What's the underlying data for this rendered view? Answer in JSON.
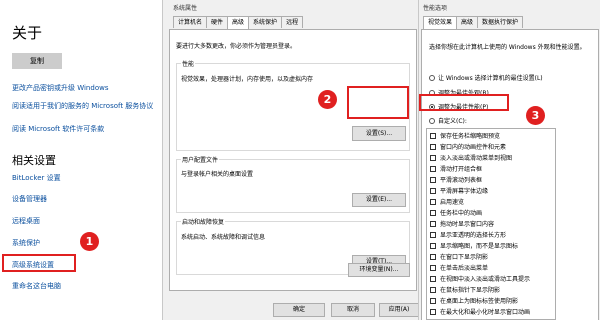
{
  "about": {
    "title": "关于",
    "copy_button": "复制",
    "links": [
      "更改产品密钥或升级 Windows",
      "阅读适用于我们的服务的 Microsoft 服务协议",
      "阅读 Microsoft 软件许可条款"
    ],
    "related_title": "相关设置",
    "related_links": [
      "BitLocker 设置",
      "设备管理器",
      "远程桌面",
      "系统保护",
      "高级系统设置",
      "重命名这台电脑"
    ]
  },
  "system_properties": {
    "title": "系统属性",
    "tabs": [
      "计算机名",
      "硬件",
      "高级",
      "系统保护",
      "远程"
    ],
    "active_tab": "高级",
    "admin_note": "要进行大多数更改，你必须作为管理员登录。",
    "performance": {
      "title": "性能",
      "description": "视觉效果，处理器计划，内存使用，以及虚拟内存",
      "button": "设置(S)..."
    },
    "user_profiles": {
      "title": "用户配置文件",
      "description": "与登录帐户相关的桌面设置",
      "button": "设置(E)..."
    },
    "startup_recovery": {
      "title": "启动和故障恢复",
      "description": "系统启动、系统故障和调试信息",
      "button": "设置(T)..."
    },
    "env_button": "环境变量(N)...",
    "ok_button": "确定",
    "cancel_button": "取消",
    "apply_button": "应用(A)"
  },
  "performance_options": {
    "title": "性能选项",
    "tabs": [
      "视觉效果",
      "高级",
      "数据执行保护"
    ],
    "active_tab": "视觉效果",
    "intro": "选择你想在此计算机上使用的 Windows 外观和性能设置。",
    "radios": [
      {
        "label": "让 Windows 选择计算机的最佳设置(L)",
        "selected": false
      },
      {
        "label": "调整为最佳外观(B)",
        "selected": false
      },
      {
        "label": "调整为最佳性能(P)",
        "selected": true
      },
      {
        "label": "自定义(C):",
        "selected": false
      }
    ],
    "checkboxes": [
      "保存任务栏缩略图预览",
      "窗口内的动画控件和元素",
      "淡入淡出或滑动菜单到视图",
      "滑动打开组合框",
      "平滑滚动列表框",
      "平滑屏幕字体边缘",
      "启用速览",
      "任务栏中的动画",
      "拖动时显示窗口内容",
      "显示亚透明的选择长方形",
      "显示缩略图，而不是显示图标",
      "在窗口下显示阴影",
      "在单击后淡出菜单",
      "在视图中淡入淡出或滑动工具提示",
      "在鼠标指针下显示阴影",
      "在桌面上为图标标签使用阴影",
      "在最大化和最小化时显示窗口动画"
    ]
  },
  "annotations": {
    "badges": [
      "1",
      "2",
      "3"
    ],
    "color": "#e02020"
  }
}
